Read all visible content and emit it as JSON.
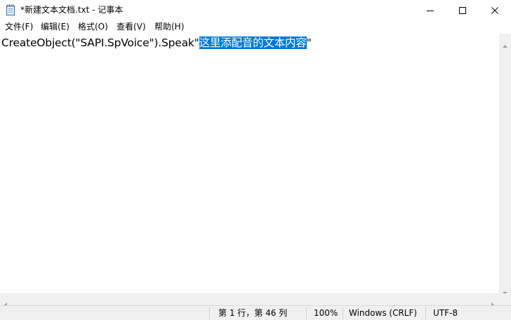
{
  "window": {
    "title": "*新建文本文档.txt - 记事本",
    "icon": "notepad-icon",
    "controls": [
      "minimize-icon",
      "maximize-icon",
      "close-icon"
    ]
  },
  "menu": {
    "items": [
      "文件(F)",
      "编辑(E)",
      "格式(O)",
      "查看(V)",
      "帮助(H)"
    ]
  },
  "editor": {
    "text_before": "CreateObject(\"SAPI.SpVoice\").Speak\"",
    "text_selected": "这里添配音的文本内容",
    "text_after": "\"",
    "selection_color": "#0078d7"
  },
  "status": {
    "position": "第 1 行，第 46 列",
    "zoom": "100%",
    "line_ending": "Windows (CRLF)",
    "encoding": "UTF-8"
  }
}
